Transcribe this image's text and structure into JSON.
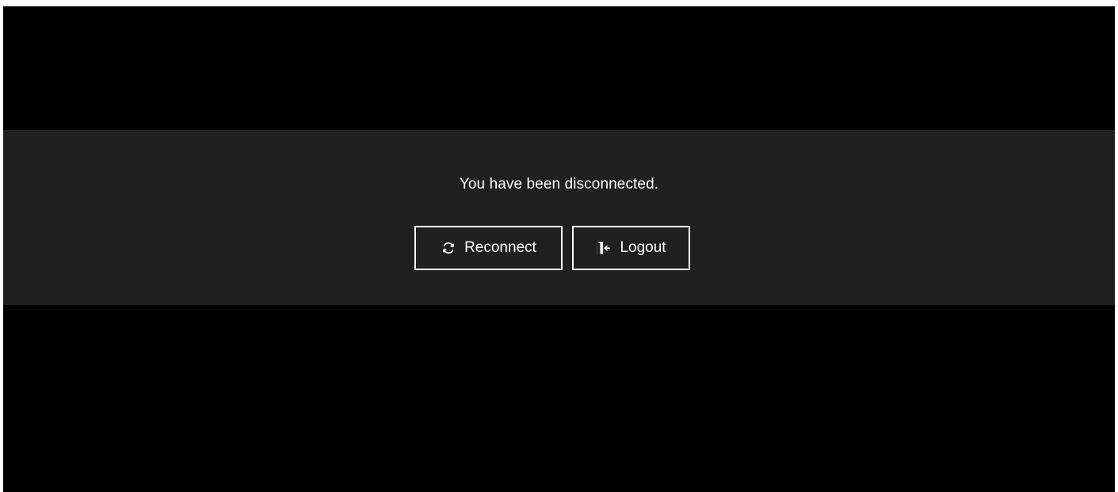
{
  "dialog": {
    "message": "You have been disconnected.",
    "buttons": [
      {
        "label": "Reconnect",
        "icon": "refresh-icon"
      },
      {
        "label": "Logout",
        "icon": "logout-door-icon"
      }
    ]
  },
  "colors": {
    "background": "#000000",
    "band": "#202020",
    "text": "#ffffff",
    "button_border": "#ffffff"
  }
}
